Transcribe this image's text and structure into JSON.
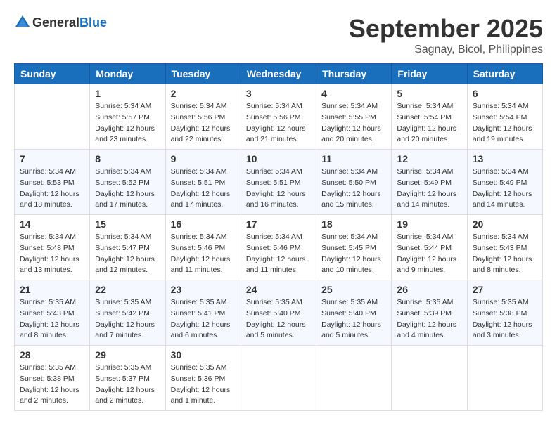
{
  "header": {
    "logo": {
      "general": "General",
      "blue": "Blue"
    },
    "title": "September 2025",
    "location": "Sagnay, Bicol, Philippines"
  },
  "calendar": {
    "columns": [
      "Sunday",
      "Monday",
      "Tuesday",
      "Wednesday",
      "Thursday",
      "Friday",
      "Saturday"
    ],
    "weeks": [
      [
        {
          "day": "",
          "info": ""
        },
        {
          "day": "1",
          "info": "Sunrise: 5:34 AM\nSunset: 5:57 PM\nDaylight: 12 hours\nand 23 minutes."
        },
        {
          "day": "2",
          "info": "Sunrise: 5:34 AM\nSunset: 5:56 PM\nDaylight: 12 hours\nand 22 minutes."
        },
        {
          "day": "3",
          "info": "Sunrise: 5:34 AM\nSunset: 5:56 PM\nDaylight: 12 hours\nand 21 minutes."
        },
        {
          "day": "4",
          "info": "Sunrise: 5:34 AM\nSunset: 5:55 PM\nDaylight: 12 hours\nand 20 minutes."
        },
        {
          "day": "5",
          "info": "Sunrise: 5:34 AM\nSunset: 5:54 PM\nDaylight: 12 hours\nand 20 minutes."
        },
        {
          "day": "6",
          "info": "Sunrise: 5:34 AM\nSunset: 5:54 PM\nDaylight: 12 hours\nand 19 minutes."
        }
      ],
      [
        {
          "day": "7",
          "info": "Sunrise: 5:34 AM\nSunset: 5:53 PM\nDaylight: 12 hours\nand 18 minutes."
        },
        {
          "day": "8",
          "info": "Sunrise: 5:34 AM\nSunset: 5:52 PM\nDaylight: 12 hours\nand 17 minutes."
        },
        {
          "day": "9",
          "info": "Sunrise: 5:34 AM\nSunset: 5:51 PM\nDaylight: 12 hours\nand 17 minutes."
        },
        {
          "day": "10",
          "info": "Sunrise: 5:34 AM\nSunset: 5:51 PM\nDaylight: 12 hours\nand 16 minutes."
        },
        {
          "day": "11",
          "info": "Sunrise: 5:34 AM\nSunset: 5:50 PM\nDaylight: 12 hours\nand 15 minutes."
        },
        {
          "day": "12",
          "info": "Sunrise: 5:34 AM\nSunset: 5:49 PM\nDaylight: 12 hours\nand 14 minutes."
        },
        {
          "day": "13",
          "info": "Sunrise: 5:34 AM\nSunset: 5:49 PM\nDaylight: 12 hours\nand 14 minutes."
        }
      ],
      [
        {
          "day": "14",
          "info": "Sunrise: 5:34 AM\nSunset: 5:48 PM\nDaylight: 12 hours\nand 13 minutes."
        },
        {
          "day": "15",
          "info": "Sunrise: 5:34 AM\nSunset: 5:47 PM\nDaylight: 12 hours\nand 12 minutes."
        },
        {
          "day": "16",
          "info": "Sunrise: 5:34 AM\nSunset: 5:46 PM\nDaylight: 12 hours\nand 11 minutes."
        },
        {
          "day": "17",
          "info": "Sunrise: 5:34 AM\nSunset: 5:46 PM\nDaylight: 12 hours\nand 11 minutes."
        },
        {
          "day": "18",
          "info": "Sunrise: 5:34 AM\nSunset: 5:45 PM\nDaylight: 12 hours\nand 10 minutes."
        },
        {
          "day": "19",
          "info": "Sunrise: 5:34 AM\nSunset: 5:44 PM\nDaylight: 12 hours\nand 9 minutes."
        },
        {
          "day": "20",
          "info": "Sunrise: 5:34 AM\nSunset: 5:43 PM\nDaylight: 12 hours\nand 8 minutes."
        }
      ],
      [
        {
          "day": "21",
          "info": "Sunrise: 5:35 AM\nSunset: 5:43 PM\nDaylight: 12 hours\nand 8 minutes."
        },
        {
          "day": "22",
          "info": "Sunrise: 5:35 AM\nSunset: 5:42 PM\nDaylight: 12 hours\nand 7 minutes."
        },
        {
          "day": "23",
          "info": "Sunrise: 5:35 AM\nSunset: 5:41 PM\nDaylight: 12 hours\nand 6 minutes."
        },
        {
          "day": "24",
          "info": "Sunrise: 5:35 AM\nSunset: 5:40 PM\nDaylight: 12 hours\nand 5 minutes."
        },
        {
          "day": "25",
          "info": "Sunrise: 5:35 AM\nSunset: 5:40 PM\nDaylight: 12 hours\nand 5 minutes."
        },
        {
          "day": "26",
          "info": "Sunrise: 5:35 AM\nSunset: 5:39 PM\nDaylight: 12 hours\nand 4 minutes."
        },
        {
          "day": "27",
          "info": "Sunrise: 5:35 AM\nSunset: 5:38 PM\nDaylight: 12 hours\nand 3 minutes."
        }
      ],
      [
        {
          "day": "28",
          "info": "Sunrise: 5:35 AM\nSunset: 5:38 PM\nDaylight: 12 hours\nand 2 minutes."
        },
        {
          "day": "29",
          "info": "Sunrise: 5:35 AM\nSunset: 5:37 PM\nDaylight: 12 hours\nand 2 minutes."
        },
        {
          "day": "30",
          "info": "Sunrise: 5:35 AM\nSunset: 5:36 PM\nDaylight: 12 hours\nand 1 minute."
        },
        {
          "day": "",
          "info": ""
        },
        {
          "day": "",
          "info": ""
        },
        {
          "day": "",
          "info": ""
        },
        {
          "day": "",
          "info": ""
        }
      ]
    ]
  }
}
